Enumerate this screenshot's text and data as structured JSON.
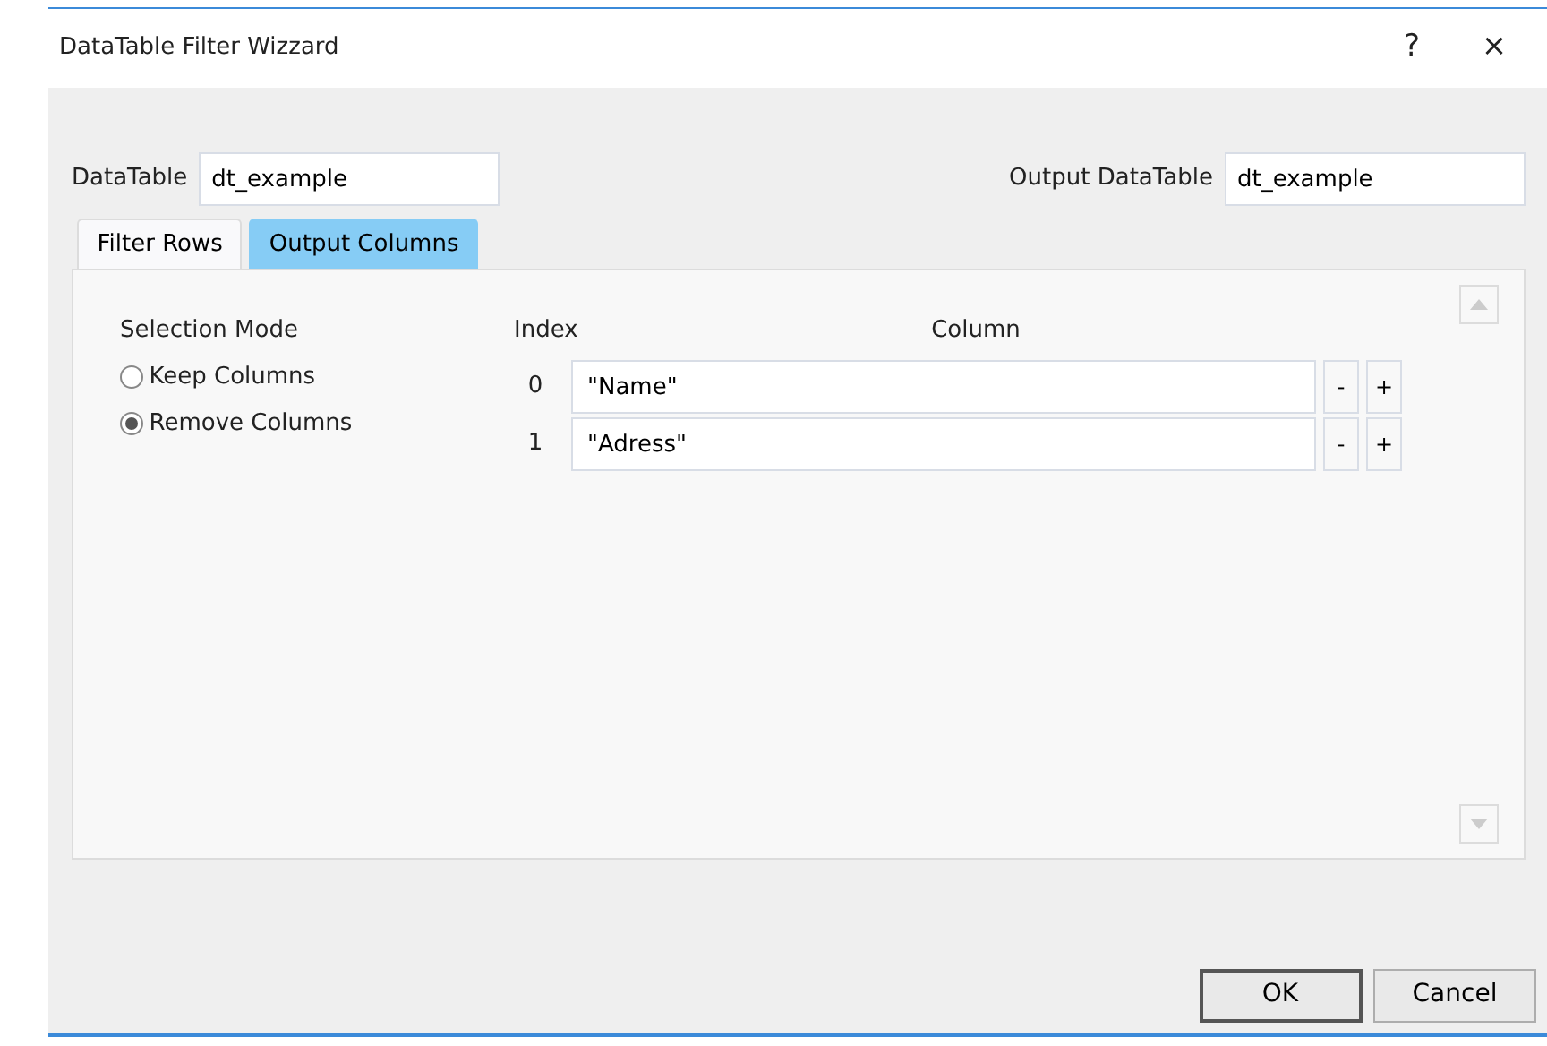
{
  "window": {
    "title": "DataTable Filter Wizzard",
    "help": "?",
    "close": "×"
  },
  "datatable": {
    "label": "DataTable",
    "value": "dt_example"
  },
  "output_datatable": {
    "label": "Output DataTable",
    "value": "dt_example"
  },
  "tabs": [
    {
      "label": "Filter Rows",
      "selected": false
    },
    {
      "label": "Output Columns",
      "selected": true
    }
  ],
  "selection_mode": {
    "title": "Selection Mode",
    "options": [
      {
        "label": "Keep Columns",
        "selected": false
      },
      {
        "label": "Remove Columns",
        "selected": true
      }
    ]
  },
  "table": {
    "columns": [
      "Index",
      "Column"
    ],
    "rows": [
      {
        "index": "0",
        "value": "\"Name\"",
        "remove": "-",
        "add": "+"
      },
      {
        "index": "1",
        "value": "\"Adress\"",
        "remove": "-",
        "add": "+"
      }
    ]
  },
  "buttons": [
    "OK",
    "Cancel"
  ]
}
